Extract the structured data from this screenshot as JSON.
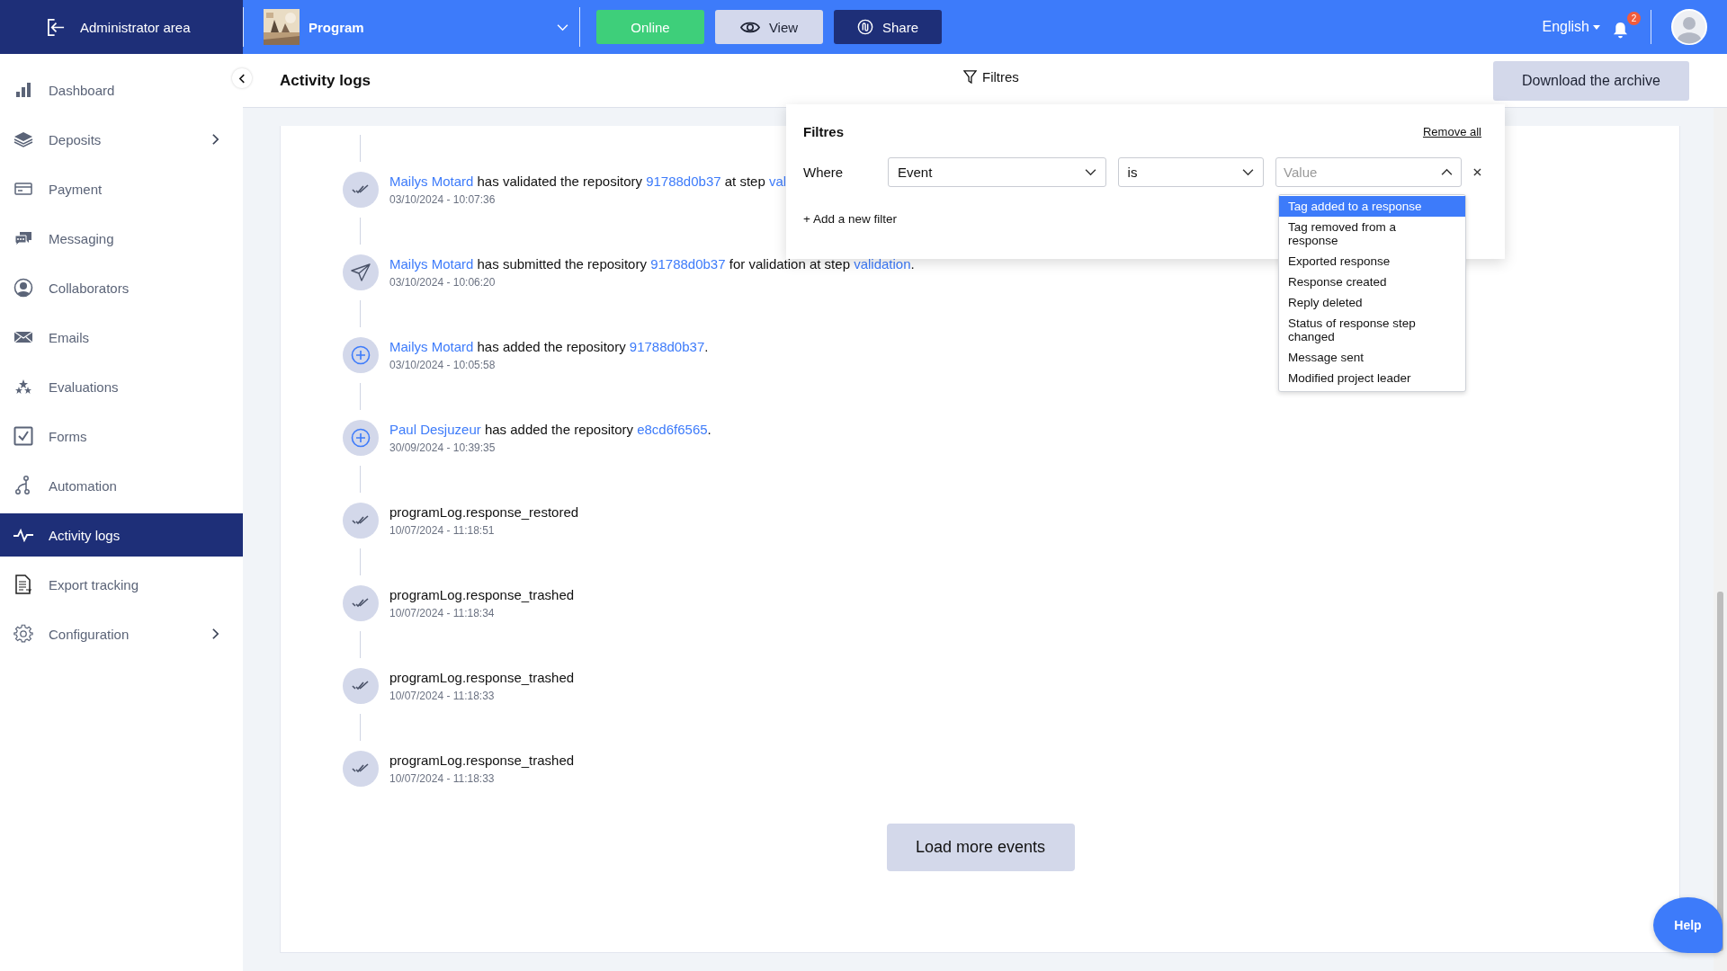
{
  "topbar": {
    "admin_link": "Administrator area",
    "program": "Program",
    "buttons": [
      {
        "label": "Online",
        "kind": "status"
      },
      {
        "label": "View",
        "kind": "view"
      },
      {
        "label": "Share",
        "kind": "share"
      }
    ],
    "language": "English",
    "notification_count": "2"
  },
  "sidebar": {
    "items": [
      {
        "label": "Dashboard",
        "has_submenu": false,
        "selected": false
      },
      {
        "label": "Deposits",
        "has_submenu": true,
        "selected": false
      },
      {
        "label": "Payment",
        "has_submenu": false,
        "selected": false
      },
      {
        "label": "Messaging",
        "has_submenu": false,
        "selected": false
      },
      {
        "label": "Collaborators",
        "has_submenu": false,
        "selected": false
      },
      {
        "label": "Emails",
        "has_submenu": false,
        "selected": false
      },
      {
        "label": "Evaluations",
        "has_submenu": false,
        "selected": false
      },
      {
        "label": "Forms",
        "has_submenu": false,
        "selected": false
      },
      {
        "label": "Automation",
        "has_submenu": false,
        "selected": false
      },
      {
        "label": "Activity logs",
        "has_submenu": false,
        "selected": true
      },
      {
        "label": "Export tracking",
        "has_submenu": false,
        "selected": false
      },
      {
        "label": "Configuration",
        "has_submenu": true,
        "selected": false
      }
    ]
  },
  "header": {
    "title": "Activity logs",
    "filter_button": "Filtres",
    "download_button": "Download the archive"
  },
  "logs": [
    {
      "kind": "validated",
      "parts": [
        {
          "kind": "user",
          "text": "Mailys Motard"
        },
        {
          "kind": "text",
          "text": " has validated the repository "
        },
        {
          "kind": "repository",
          "text": "91788d0b37"
        },
        {
          "kind": "text",
          "text": " at step "
        },
        {
          "kind": "step",
          "text": "val"
        }
      ],
      "time": "03/10/2024 - 10:07:36"
    },
    {
      "kind": "submitted",
      "parts": [
        {
          "kind": "user",
          "text": "Mailys Motard"
        },
        {
          "kind": "text",
          "text": " has submitted the repository "
        },
        {
          "kind": "repository",
          "text": "91788d0b37"
        },
        {
          "kind": "text",
          "text": " for validation at step "
        },
        {
          "kind": "step",
          "text": "validation"
        },
        {
          "kind": "text",
          "text": "."
        }
      ],
      "time": "03/10/2024 - 10:06:20"
    },
    {
      "kind": "added",
      "parts": [
        {
          "kind": "user",
          "text": "Mailys Motard"
        },
        {
          "kind": "text",
          "text": " has added the repository "
        },
        {
          "kind": "repository",
          "text": "91788d0b37"
        },
        {
          "kind": "text",
          "text": "."
        }
      ],
      "time": "03/10/2024 - 10:05:58"
    },
    {
      "kind": "added",
      "parts": [
        {
          "kind": "user",
          "text": "Paul Desjuzeur"
        },
        {
          "kind": "text",
          "text": " has added the repository "
        },
        {
          "kind": "repository",
          "text": "e8cd6f6565"
        },
        {
          "kind": "text",
          "text": "."
        }
      ],
      "time": "30/09/2024 - 10:39:35"
    },
    {
      "kind": "validated",
      "parts": [
        {
          "kind": "text",
          "text": "programLog.response_restored"
        }
      ],
      "time": "10/07/2024 - 11:18:51"
    },
    {
      "kind": "validated",
      "parts": [
        {
          "kind": "text",
          "text": "programLog.response_trashed"
        }
      ],
      "time": "10/07/2024 - 11:18:34"
    },
    {
      "kind": "validated",
      "parts": [
        {
          "kind": "text",
          "text": "programLog.response_trashed"
        }
      ],
      "time": "10/07/2024 - 11:18:33"
    },
    {
      "kind": "validated",
      "parts": [
        {
          "kind": "text",
          "text": "programLog.response_trashed"
        }
      ],
      "time": "10/07/2024 - 11:18:33"
    }
  ],
  "load_more": "Load more events",
  "filter_panel": {
    "title": "Filtres",
    "remove_all": "Remove all",
    "where": "Where",
    "field": "Event",
    "operator": "is",
    "value_placeholder": "Value",
    "add_filter": "+ Add a new filter",
    "options": [
      {
        "label": "Tag added to a response",
        "selected": true
      },
      {
        "label": "Tag removed from a response",
        "selected": false
      },
      {
        "label": "Exported response",
        "selected": false
      },
      {
        "label": "Response created",
        "selected": false
      },
      {
        "label": "Reply deleted",
        "selected": false
      },
      {
        "label": "Status of response step changed",
        "selected": false
      },
      {
        "label": "Message sent",
        "selected": false
      },
      {
        "label": "Modified project leader",
        "selected": false
      }
    ]
  },
  "help": "Help"
}
